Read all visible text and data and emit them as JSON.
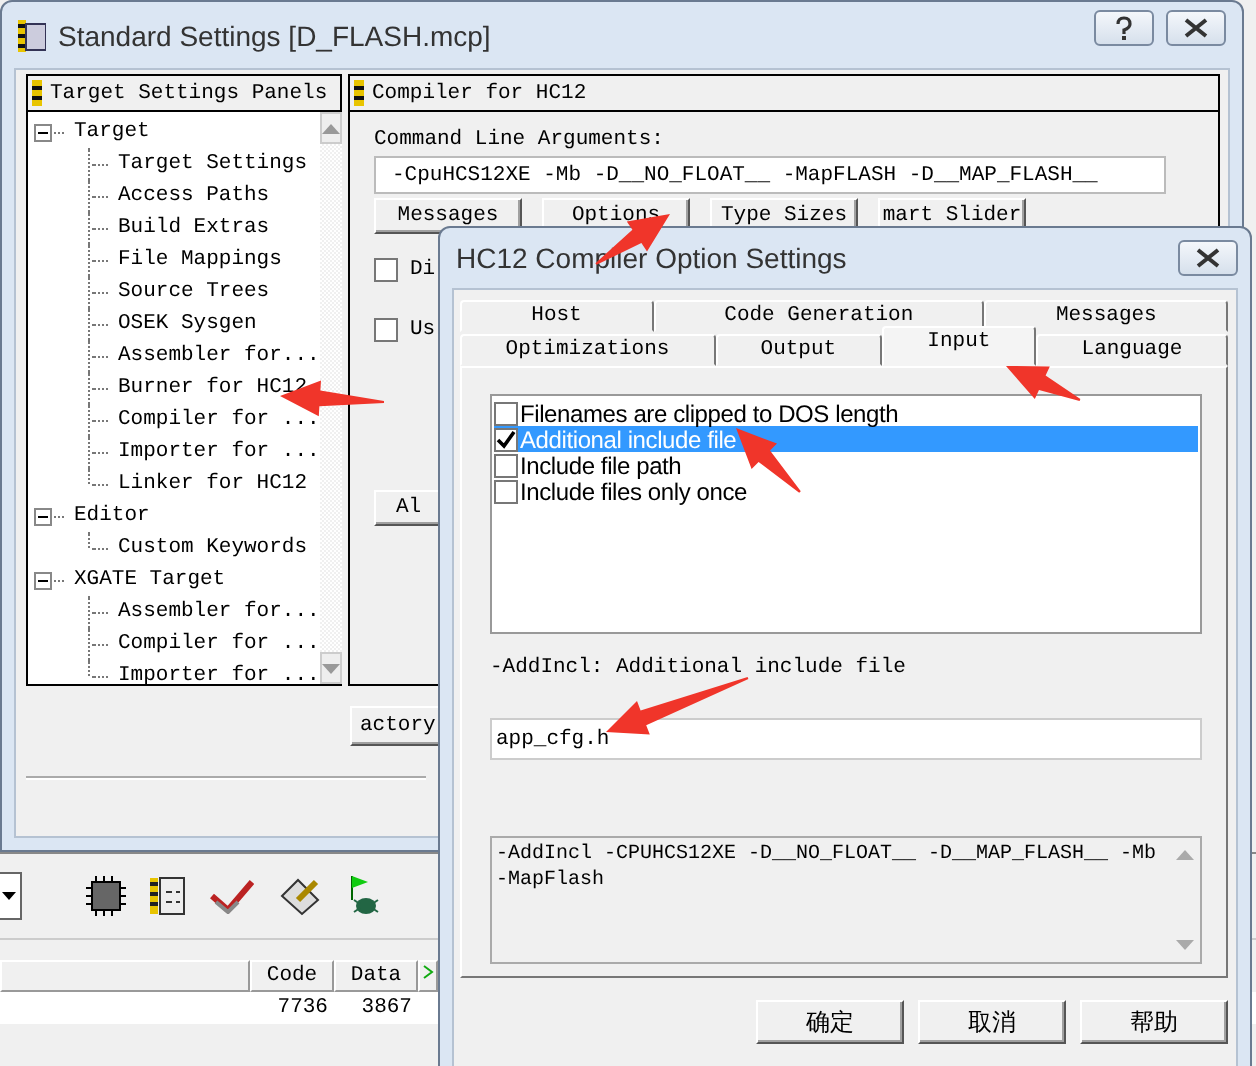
{
  "settings_window": {
    "title": "Standard Settings [D_FLASH.mcp]",
    "panels_header": "Target Settings Panels",
    "tree": [
      {
        "label": "Target",
        "expanded": true,
        "children": [
          {
            "label": "Target Settings"
          },
          {
            "label": "Access Paths"
          },
          {
            "label": "Build Extras"
          },
          {
            "label": "File Mappings"
          },
          {
            "label": "Source Trees"
          },
          {
            "label": "OSEK Sysgen"
          },
          {
            "label": "Assembler for..."
          },
          {
            "label": "Burner for HC12"
          },
          {
            "label": "Compiler for ..."
          },
          {
            "label": "Importer for ..."
          },
          {
            "label": "Linker for HC12"
          }
        ]
      },
      {
        "label": "Editor",
        "expanded": true,
        "children": [
          {
            "label": "Custom Keywords"
          }
        ]
      },
      {
        "label": "XGATE Target",
        "expanded": true,
        "children": [
          {
            "label": "Assembler for..."
          },
          {
            "label": "Compiler for ..."
          },
          {
            "label": "Importer for ..."
          }
        ]
      }
    ],
    "panel_header": "Compiler for HC12",
    "command_line_label": "Command Line Arguments:",
    "command_line": "-CpuHCS12XE -Mb -D__NO_FLOAT__ -MapFLASH -D__MAP_FLASH__",
    "buttons": [
      "Messages",
      "Options",
      "Type Sizes",
      "mart Slider"
    ],
    "checkboxes": [
      {
        "label": "Di",
        "checked": false
      },
      {
        "label": "Us",
        "checked": false
      }
    ],
    "partial_button": "Al",
    "factory_button": "actory"
  },
  "ide": {
    "columns": [
      "Code",
      "Data"
    ],
    "row": [
      "7736",
      "3867"
    ]
  },
  "option_dialog": {
    "title": "HC12 Compiler Option Settings",
    "tab_rows": [
      [
        {
          "label": "Host",
          "selected": false
        },
        {
          "label": "Code Generation",
          "selected": false
        },
        {
          "label": "Messages",
          "selected": false
        }
      ],
      [
        {
          "label": "Optimizations",
          "selected": false
        },
        {
          "label": "Output",
          "selected": false
        },
        {
          "label": "Input",
          "selected": true
        },
        {
          "label": "Language",
          "selected": false
        }
      ]
    ],
    "options": [
      {
        "label": "Filenames are clipped to DOS length",
        "checked": false,
        "selected": false
      },
      {
        "label": "Additional include file",
        "checked": true,
        "selected": true
      },
      {
        "label": "Include file path",
        "checked": false,
        "selected": false
      },
      {
        "label": "Include files only once",
        "checked": false,
        "selected": false
      }
    ],
    "option_label": "-AddIncl: Additional include file",
    "value": "app_cfg.h",
    "command_preview": "-AddIncl -CPUHCS12XE -D__NO_FLOAT__ -D__MAP_FLASH__ -Mb -MapFlash",
    "buttons": [
      "确定",
      "取消",
      "帮助"
    ]
  }
}
